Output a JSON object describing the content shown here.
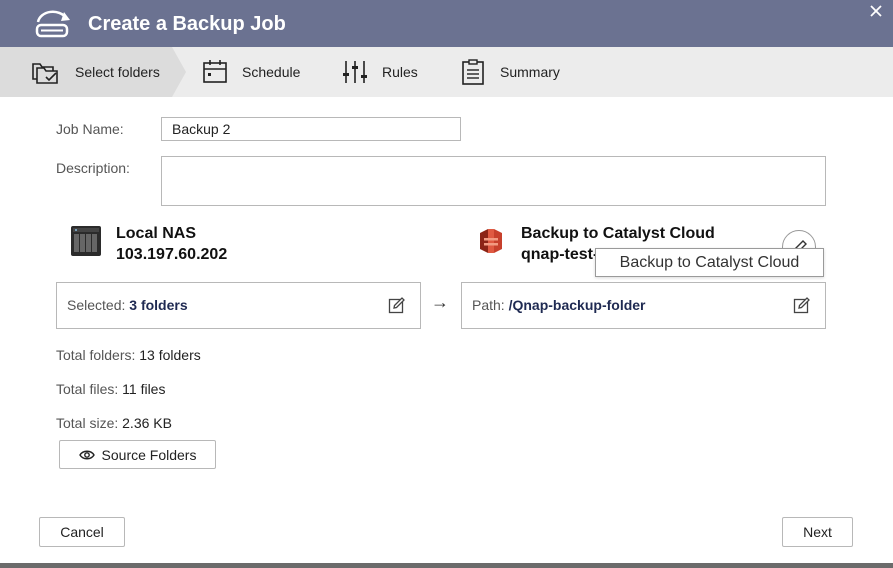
{
  "window": {
    "title": "Create a Backup Job",
    "title_icon": "backup-job-icon",
    "close_icon": "close-icon"
  },
  "steps": [
    {
      "label": "Select folders",
      "icon": "folders-icon",
      "active": true
    },
    {
      "label": "Schedule",
      "icon": "calendar-icon",
      "active": false
    },
    {
      "label": "Rules",
      "icon": "sliders-icon",
      "active": false
    },
    {
      "label": "Summary",
      "icon": "clipboard-icon",
      "active": false
    }
  ],
  "form": {
    "job_name_label": "Job Name:",
    "job_name_value": "Backup 2",
    "description_label": "Description:",
    "description_value": ""
  },
  "source": {
    "name": "Local NAS",
    "address": "103.197.60.202",
    "icon": "nas-device-icon",
    "selected_label": "Selected:",
    "selected_value": "3 folders"
  },
  "destination": {
    "name": "Backup to Catalyst Cloud",
    "subtitle": "qnap-test-",
    "icon": "s3-bucket-icon",
    "path_label": "Path:",
    "path_value": "/Qnap-backup-folder",
    "tooltip": "Backup to Catalyst Cloud"
  },
  "arrow": "→",
  "stats": {
    "folders_label": "Total folders:",
    "folders_value": "13 folders",
    "files_label": "Total files:",
    "files_value": "11 files",
    "size_label": "Total size:",
    "size_value": "2.36 KB"
  },
  "buttons": {
    "source_folders": "Source Folders",
    "cancel": "Cancel",
    "next": "Next"
  },
  "colors": {
    "titlebar": "#6b7291",
    "accent_text": "#1f2a52",
    "s3_red": "#c7402c"
  }
}
